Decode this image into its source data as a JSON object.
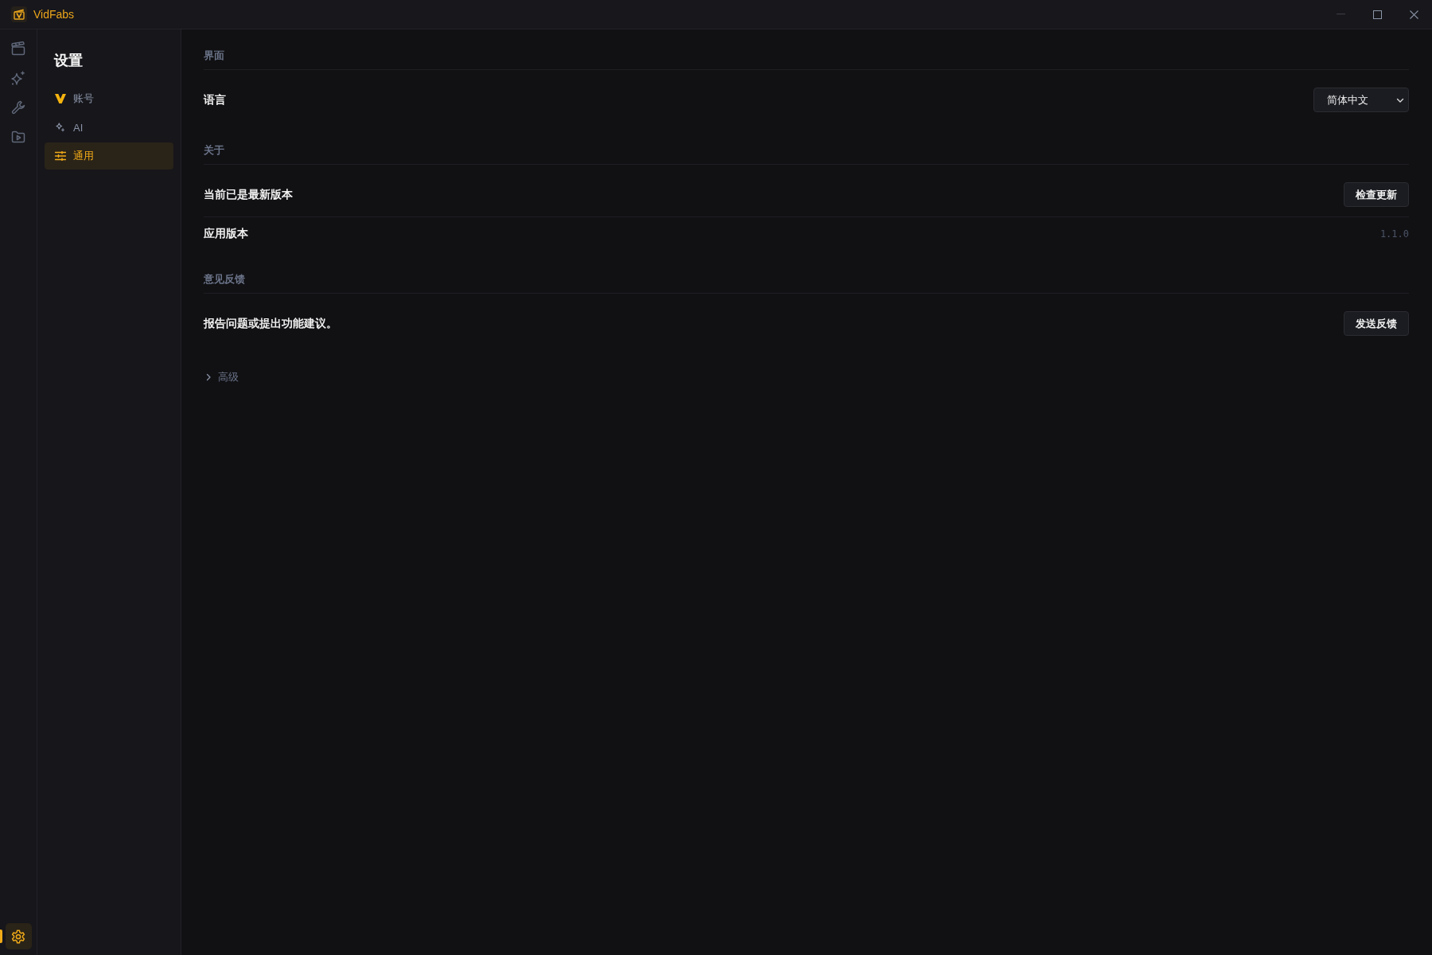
{
  "window": {
    "title": "VidFabs"
  },
  "rail": {
    "items": [
      {
        "kind": "clapper",
        "selected": false
      },
      {
        "kind": "sparkle",
        "selected": false
      },
      {
        "kind": "wrench",
        "selected": false
      },
      {
        "kind": "folder-play",
        "selected": false
      }
    ],
    "bottom": {
      "kind": "gear",
      "selected": true
    }
  },
  "sidebar": {
    "title": "设置",
    "items": [
      {
        "kind": "brand",
        "label": "账号",
        "selected": false
      },
      {
        "kind": "sparkle",
        "label": "AI",
        "selected": false
      },
      {
        "kind": "sliders",
        "label": "通用",
        "selected": true
      }
    ]
  },
  "sections": [
    {
      "title": "界面",
      "rows": [
        {
          "kind": "select",
          "label": "语言",
          "value": "简体中文"
        }
      ]
    },
    {
      "title": "关于",
      "rows": [
        {
          "kind": "button",
          "label": "当前已是最新版本",
          "button": "检查更新"
        },
        {
          "kind": "value",
          "label": "应用版本",
          "value": "1.1.0"
        }
      ]
    },
    {
      "title": "意见反馈",
      "rows": [
        {
          "kind": "button",
          "label": "报告问题或提出功能建议。",
          "button": "发送反馈"
        }
      ]
    }
  ],
  "advanced": {
    "label": "高级",
    "expanded": false
  }
}
